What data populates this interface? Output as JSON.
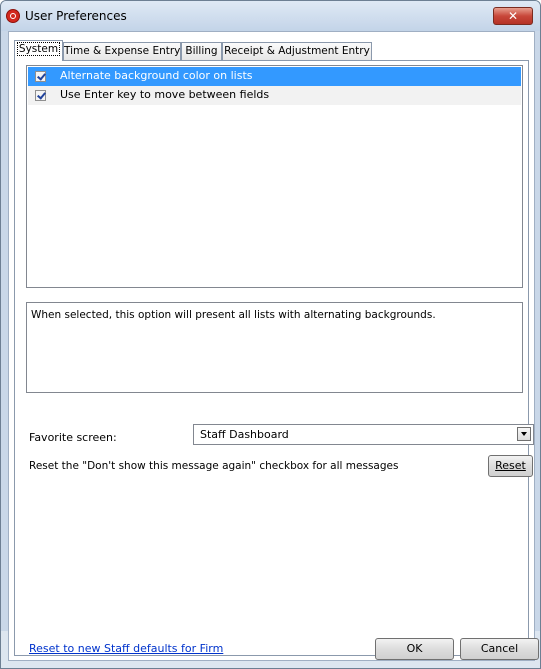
{
  "window": {
    "title": "User Preferences",
    "close_label": "✕"
  },
  "tabs": [
    {
      "label": "System",
      "active": true
    },
    {
      "label": "Time & Expense Entry",
      "active": false
    },
    {
      "label": "Billing",
      "active": false
    },
    {
      "label": "Receipt & Adjustment Entry",
      "active": false
    }
  ],
  "options": [
    {
      "label": "Alternate background color on lists",
      "checked": true,
      "selected": true
    },
    {
      "label": "Use Enter key to move between fields",
      "checked": true,
      "selected": false
    }
  ],
  "description": "When selected, this option will present all lists with alternating backgrounds.",
  "favorite_screen": {
    "label": "Favorite screen:",
    "value": "Staff Dashboard"
  },
  "reset_messages": {
    "text": "Reset the \"Don't show this message again\" checkbox for all messages",
    "button_label": "Reset"
  },
  "footer": {
    "link_label": "Reset to new Staff defaults for Firm",
    "ok_label": "OK",
    "cancel_label": "Cancel"
  },
  "colors": {
    "selection": "#3399ff",
    "link": "#0033cc"
  }
}
